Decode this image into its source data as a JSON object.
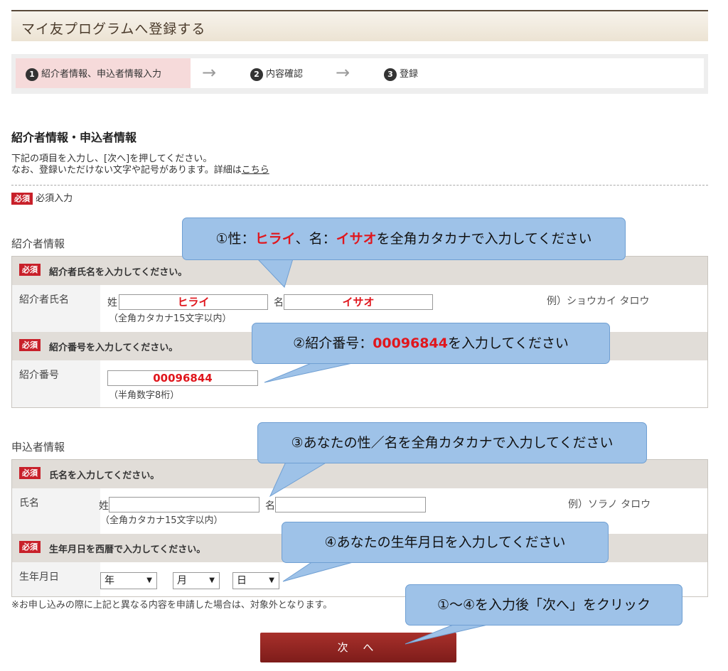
{
  "header": {
    "title": "マイ友プログラムへ登録する"
  },
  "steps": [
    {
      "num": "1",
      "label": "紹介者情報、申込者情報入力"
    },
    {
      "num": "2",
      "label": "内容確認"
    },
    {
      "num": "3",
      "label": "登録"
    }
  ],
  "step_arrow": "→",
  "section_title": "紹介者情報・申込者情報",
  "intro": {
    "line1": "下記の項目を入力し、[次へ]を押してください。",
    "line2_prefix": "なお、登録いただけない文字や記号があります。詳細は",
    "line2_link": "こちら"
  },
  "required_badge": "必須",
  "required_legend": "必須入力",
  "referrer": {
    "label": "紹介者情報",
    "name_header": "紹介者氏名を入力してください。",
    "name_label": "紹介者氏名",
    "sei_label": "姓",
    "mei_label": "名",
    "sei_value": "ヒライ",
    "mei_value": "イサオ",
    "name_note": "（全角カタカナ15文字以内）",
    "name_example": "例）ショウカイ タロウ",
    "number_header": "紹介番号を入力してください。",
    "number_label": "紹介番号",
    "number_value": "00096844",
    "number_note": "（半角数字8桁）"
  },
  "applicant": {
    "label": "申込者情報",
    "name_header": "氏名を入力してください。",
    "name_label": "氏名",
    "sei_label": "姓",
    "mei_label": "名",
    "sei_value": "",
    "mei_value": "",
    "name_note": "（全角カタカナ15文字以内）",
    "name_example": "例）ソラノ タロウ",
    "birth_header": "生年月日を西暦で入力してください。",
    "birth_label": "生年月日",
    "year": "年",
    "month": "月",
    "day": "日"
  },
  "footnote": "※お申し込みの際に上記と異なる内容を申請した場合は、対象外となります。",
  "next_button": "次 へ",
  "callouts": {
    "c1_a": "①性：",
    "c1_b": "ヒライ",
    "c1_c": "、名：",
    "c1_d": "イサオ",
    "c1_e": "を全角カタカナで入力してください",
    "c2_a": "②紹介番号：",
    "c2_b": "00096844",
    "c2_c": "を入力してください",
    "c3": "③あなたの性／名を全角カタカナで入力してください",
    "c4": "④あなたの生年月日を入力してください",
    "c5": "①～④を入力後「次へ」をクリック"
  },
  "colors": {
    "required_red": "#c8202a",
    "callout_blue": "#9ec2e8",
    "button_red": "#8e2220",
    "highlight_red": "#e0161d"
  }
}
